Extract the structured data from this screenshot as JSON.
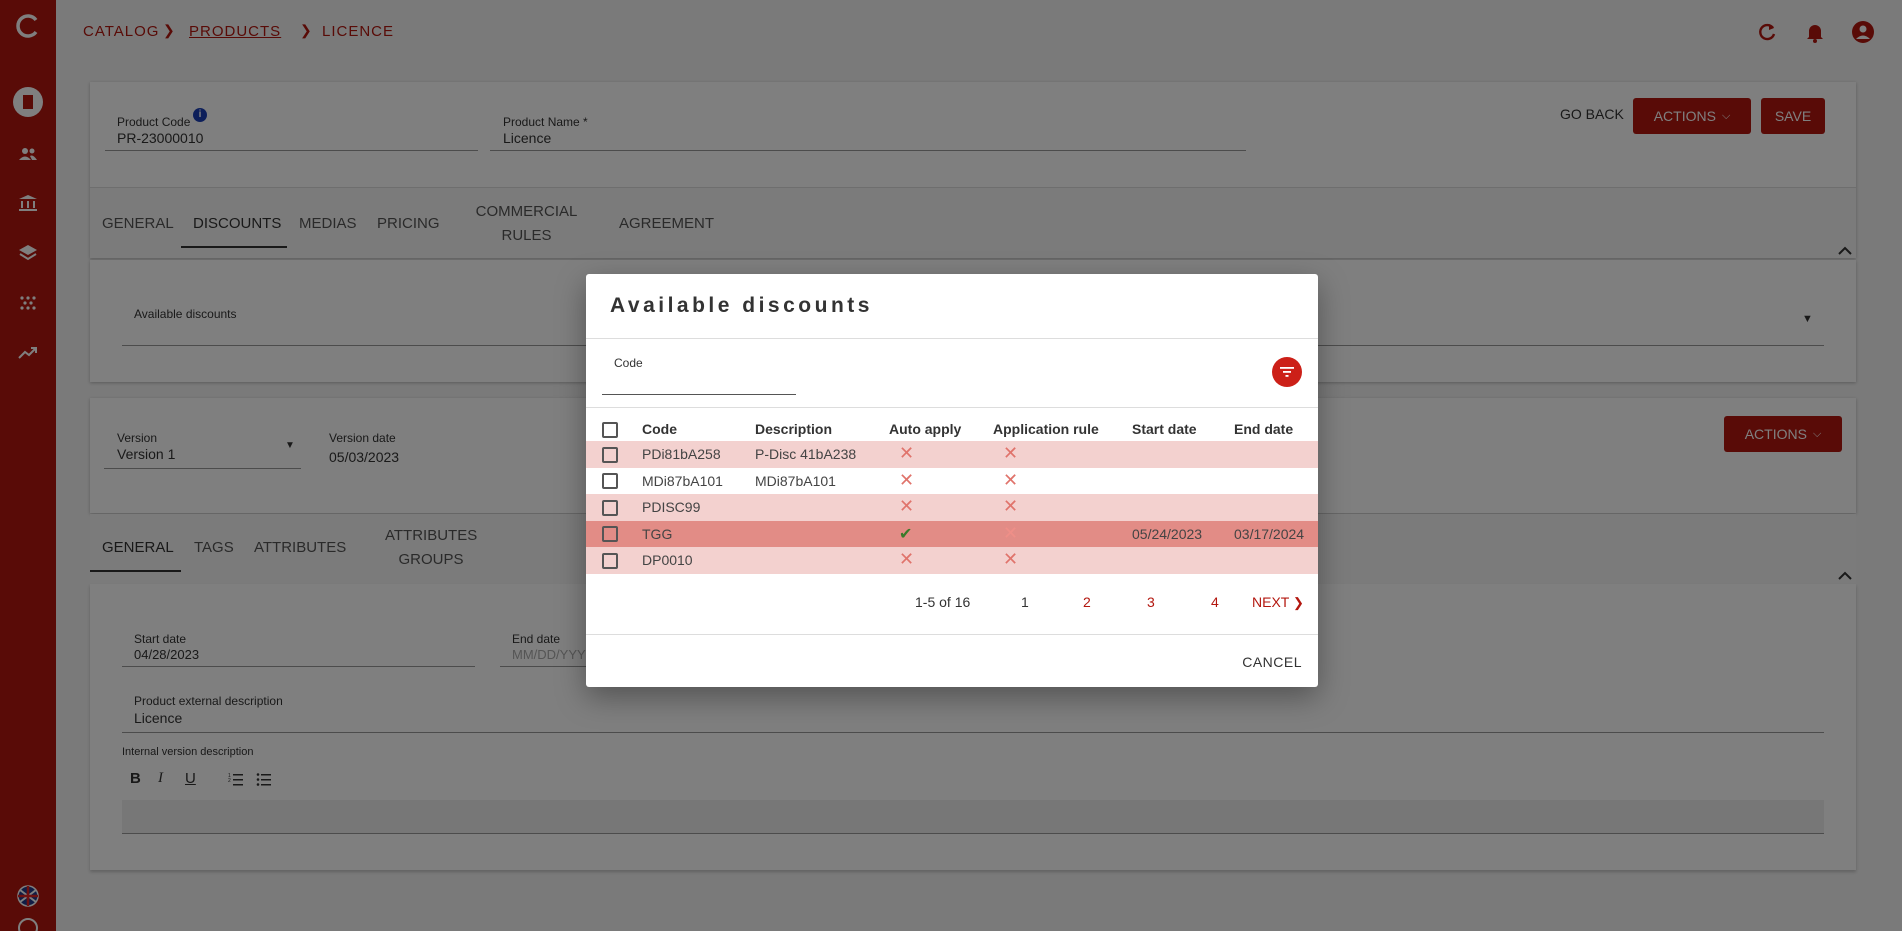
{
  "breadcrumb": {
    "catalog": "CATALOG",
    "products": "PRODUCTS",
    "licence": "LICENCE"
  },
  "header": {
    "product_code_label": "Product Code",
    "product_code": "PR-23000010",
    "product_name_label": "Product Name *",
    "product_name": "Licence",
    "go_back": "GO BACK",
    "actions": "ACTIONS",
    "save": "SAVE"
  },
  "product_tabs": [
    {
      "label": "GENERAL"
    },
    {
      "label": "DISCOUNTS"
    },
    {
      "label": "MEDIAS"
    },
    {
      "label": "PRICING"
    },
    {
      "label": "COMMERCIAL RULES"
    },
    {
      "label": "AGREEMENT"
    }
  ],
  "discounts_panel": {
    "available_label": "Available discounts"
  },
  "version": {
    "version_label": "Version",
    "version_value": "Version 1",
    "date_label": "Version date",
    "date_value": "05/03/2023",
    "actions": "ACTIONS"
  },
  "version_tabs": [
    {
      "label": "GENERAL"
    },
    {
      "label": "TAGS"
    },
    {
      "label": "ATTRIBUTES"
    },
    {
      "label": "ATTRIBUTES GROUPS"
    }
  ],
  "version_general": {
    "start_label": "Start date",
    "start_value": "04/28/2023",
    "end_label": "End date",
    "end_placeholder": "MM/DD/YYYY",
    "ext_desc_label": "Product external description",
    "ext_desc_value": "Licence",
    "internal_label": "Internal version description",
    "toolbar": {
      "bold": "B",
      "italic": "I",
      "underline": "U"
    }
  },
  "dialog": {
    "title": "Available discounts",
    "filter_label": "Code",
    "columns": [
      "Code",
      "Description",
      "Auto apply",
      "Application rule",
      "Start date",
      "End date"
    ],
    "rows": [
      {
        "code": "PDi81bA258",
        "description": "P-Disc 41bA238",
        "auto_apply": false,
        "application_rule": false,
        "start": "",
        "end": ""
      },
      {
        "code": "MDi87bA101",
        "description": "MDi87bA101",
        "auto_apply": false,
        "application_rule": false,
        "start": "",
        "end": ""
      },
      {
        "code": "PDISC99",
        "description": "",
        "auto_apply": false,
        "application_rule": false,
        "start": "",
        "end": ""
      },
      {
        "code": "TGG",
        "description": "",
        "auto_apply": true,
        "application_rule": false,
        "start": "05/24/2023",
        "end": "03/17/2024"
      },
      {
        "code": "DP0010",
        "description": "",
        "auto_apply": false,
        "application_rule": false,
        "start": "",
        "end": ""
      }
    ],
    "pagination": {
      "range": "1-5 of 16",
      "pages": [
        "1",
        "2",
        "3",
        "4"
      ],
      "next": "NEXT"
    },
    "cancel": "CANCEL"
  },
  "colors": {
    "brand": "#b3170f",
    "row_highlight": "#f3d1cf",
    "row_selected": "#e28c86"
  }
}
